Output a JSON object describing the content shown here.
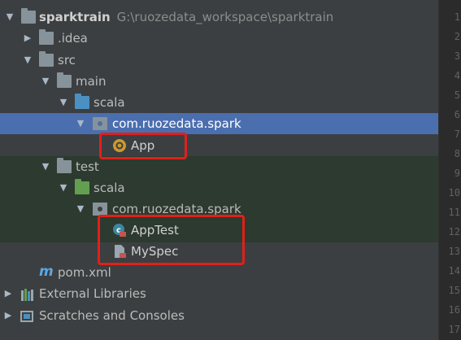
{
  "project": {
    "name": "sparktrain",
    "path": "G:\\ruozedata_workspace\\sparktrain"
  },
  "tree": {
    "idea": ".idea",
    "src": "src",
    "main": "main",
    "main_scala": "scala",
    "main_package": "com.ruozedata.spark",
    "app": "App",
    "test": "test",
    "test_scala": "scala",
    "test_package": "com.ruozedata.spark",
    "app_test": "AppTest",
    "my_spec": "MySpec",
    "pom_icon_letter": "m",
    "pom": "pom.xml",
    "external_libraries": "External Libraries",
    "scratches": "Scratches and Consoles"
  },
  "gutter": {
    "line_numbers": [
      "1",
      "2",
      "3",
      "4",
      "5",
      "6",
      "7",
      "8",
      "9",
      "10",
      "11",
      "12",
      "13",
      "14",
      "15",
      "16",
      "17"
    ]
  },
  "colors": {
    "background": "#3c3f41",
    "selection": "#4b6eaf",
    "highlight_box": "#e0201a",
    "test_background": "#2d3a2f"
  }
}
